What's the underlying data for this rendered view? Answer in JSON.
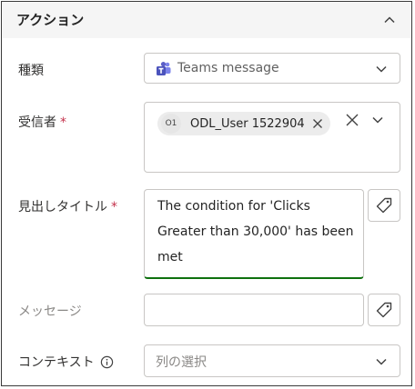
{
  "header": {
    "title": "アクション",
    "collapse_icon": "chevron-up-icon"
  },
  "fields": {
    "type": {
      "label": "種類",
      "value": "Teams message",
      "icon": "teams-icon"
    },
    "recipient": {
      "label": "受信者",
      "required_mark": "*",
      "chip_initials": "O1",
      "chip_name": "ODL_User 1522904"
    },
    "headline": {
      "label": "見出しタイトル",
      "required_mark": "*",
      "value": "The condition for 'Clicks Greater than 30,000' has been met"
    },
    "message": {
      "label": "メッセージ",
      "value": ""
    },
    "context": {
      "label": "コンテキスト",
      "placeholder": "列の選択",
      "info_icon": "info-icon"
    }
  },
  "colors": {
    "accent_underline": "#0e700e",
    "teams_purple": "#5b5fc7",
    "required": "#c4314b"
  }
}
